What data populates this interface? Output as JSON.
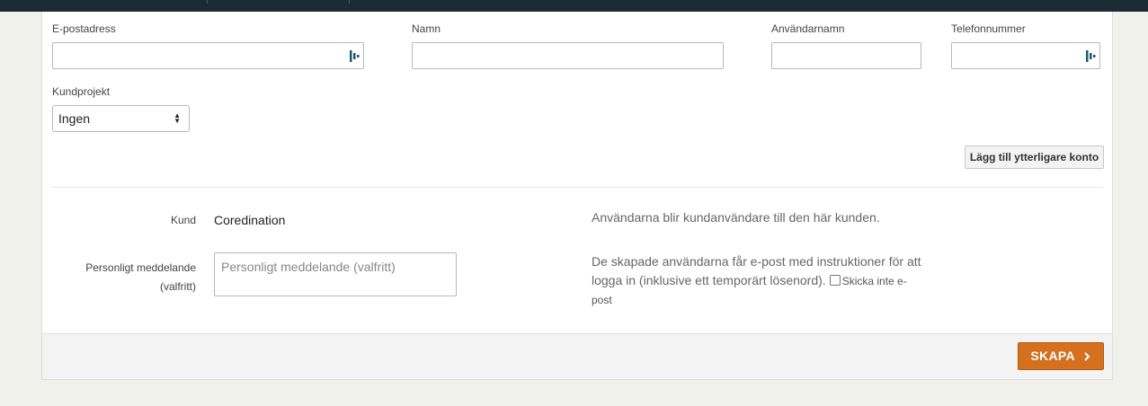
{
  "fields": {
    "email_label": "E-postadress",
    "name_label": "Namn",
    "username_label": "Användarnamn",
    "phone_label": "Telefonnummer",
    "email_value": "",
    "name_value": "",
    "username_value": "",
    "phone_value": "",
    "project_label": "Kundprojekt",
    "project_selected": "Ingen"
  },
  "buttons": {
    "add_account": "Lägg till ytterligare konto",
    "create": "SKAPA"
  },
  "customer": {
    "label": "Kund",
    "value": "Coredination",
    "info": "Användarna blir kundanvändare till den här kunden."
  },
  "message": {
    "label_line1": "Personligt meddelande",
    "label_line2": "(valfritt)",
    "placeholder": "Personligt meddelande (valfritt)",
    "info_line1": "De skapade användarna får e-post med instruktioner för att",
    "info_line2": "logga in (inklusive ett temporärt lösenord).",
    "checkbox_label_part1": "Skicka inte e-",
    "checkbox_label_part2": "post"
  },
  "icons": {
    "password_manager": "password-manager-icon",
    "select_arrows": "updown-arrows-icon",
    "create_chevron": "chevron-right-icon"
  },
  "colors": {
    "primary_button": "#d4701e",
    "topbar": "#1c2a33",
    "password_icon": "#1e5a6e"
  }
}
